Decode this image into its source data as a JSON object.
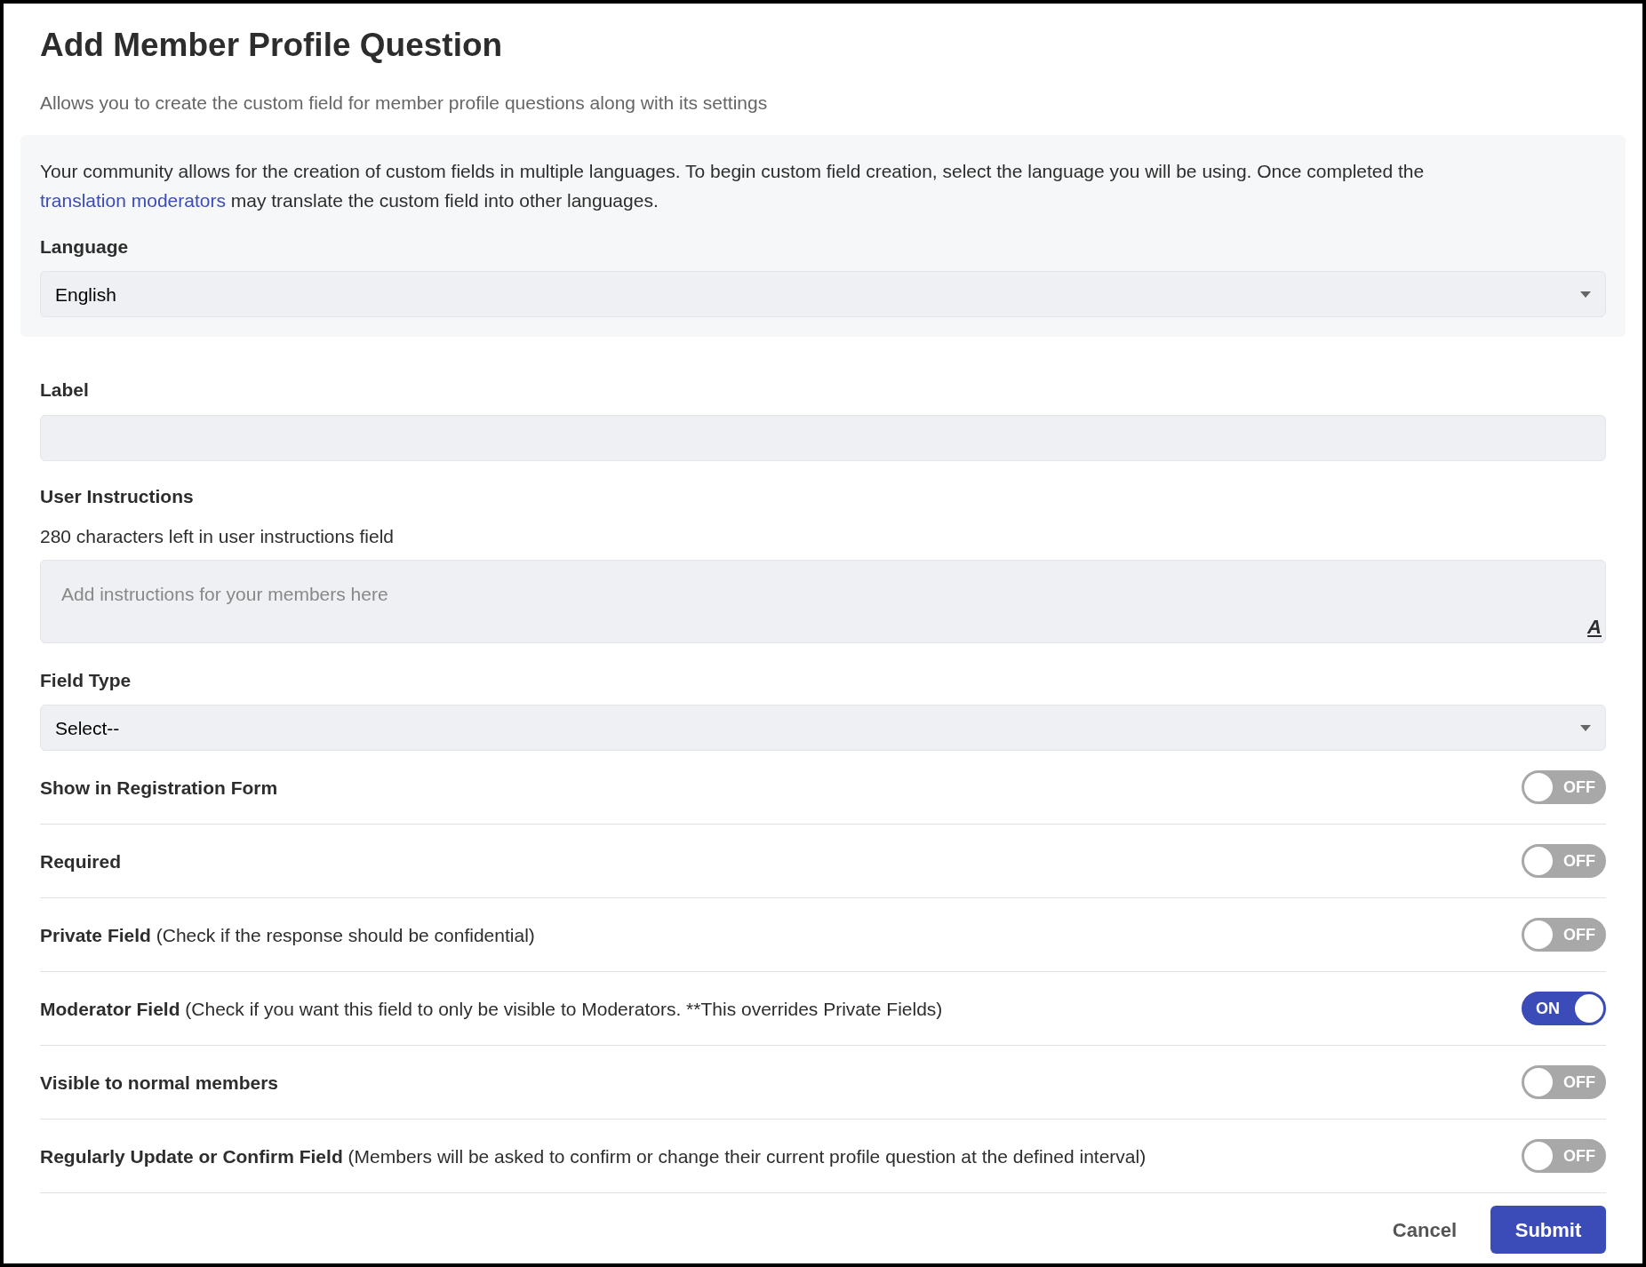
{
  "title": "Add Member Profile Question",
  "subtitle": "Allows you to create the custom field for member profile questions along with its settings",
  "language_panel": {
    "info_link": "translation moderators",
    "info_before": "Your community allows for the creation of custom fields in multiple languages. To begin custom field creation, select the language you will be using. Once completed the",
    "info_after": "may translate the custom field into other languages.",
    "label": "Language",
    "value": "English"
  },
  "label_field": {
    "label": "Label"
  },
  "instructions": {
    "label": "User Instructions",
    "counter": "280 characters left in user instructions field",
    "placeholder": "Add instructions for your members here",
    "format_icon_text": "A"
  },
  "field_type": {
    "label": "Field Type",
    "value": "Select--"
  },
  "toggles": [
    {
      "label": "Show in Registration Form",
      "on": false,
      "state_text": "OFF"
    },
    {
      "label": "Required",
      "on": false,
      "state_text": "OFF"
    },
    {
      "label": "Private Field",
      "note": "(Check if the response should be confidential)",
      "on": false,
      "state_text": "OFF"
    },
    {
      "label": "Moderator Field",
      "note": "(Check if you want this field to only be visible to Moderators. **This overrides Private Fields)",
      "on": true,
      "state_text": "ON"
    },
    {
      "label": "Visible to normal members",
      "on": false,
      "state_text": "OFF"
    },
    {
      "label": "Regularly Update or Confirm Field",
      "note": "(Members will be asked to confirm or change their current profile question at the defined interval)",
      "on": false,
      "state_text": "OFF"
    }
  ],
  "buttons": {
    "cancel": "Cancel",
    "submit": "Submit"
  }
}
